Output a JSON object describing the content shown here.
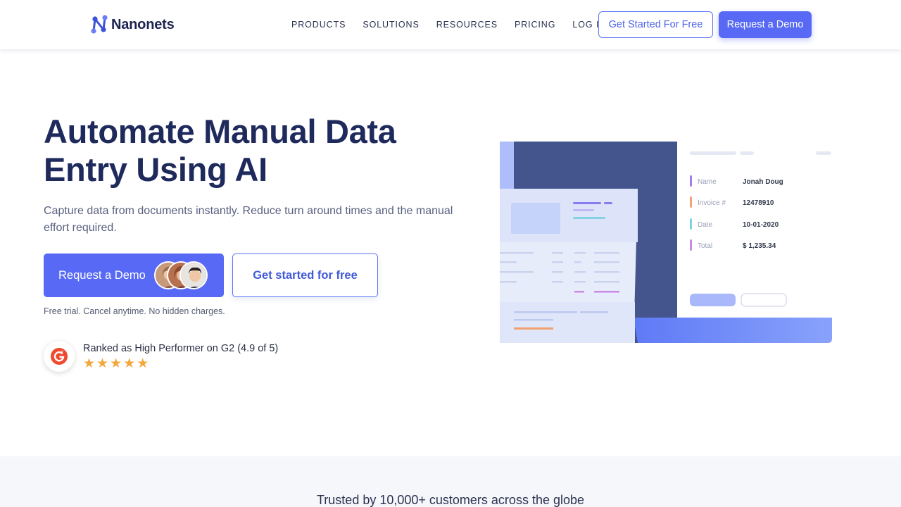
{
  "header": {
    "logo_text": "Nanonets",
    "nav": [
      "PRODUCTS",
      "SOLUTIONS",
      "RESOURCES",
      "PRICING",
      "LOG IN"
    ],
    "cta_outline": "Get Started For Free",
    "cta_solid": "Request a Demo"
  },
  "hero": {
    "title_line1": "Automate Manual Data",
    "title_line2": "Entry Using AI",
    "subtitle": "Capture data from documents instantly. Reduce turn around times and the manual effort required.",
    "primary_button": "Request a Demo",
    "secondary_button": "Get started for free",
    "note": "Free trial. Cancel anytime. No hidden charges.",
    "rating_text": "Ranked as High Performer on G2 (4.9 of 5)",
    "stars": 5
  },
  "invoice_card": {
    "fields": [
      {
        "label": "Name",
        "value": "Jonah Doug",
        "color": "#a77bf0"
      },
      {
        "label": "Invoice #",
        "value": "12478910",
        "color": "#f2a27a"
      },
      {
        "label": "Date",
        "value": "10-01-2020",
        "color": "#7fd3e6"
      },
      {
        "label": "Total",
        "value": "$ 1,235.34",
        "color": "#c98ae6"
      }
    ]
  },
  "trusted": {
    "text": "Trusted by 10,000+ customers across the globe"
  },
  "colors": {
    "primary": "#5769f5",
    "title": "#1f2a5c",
    "star": "#f3a73b"
  }
}
